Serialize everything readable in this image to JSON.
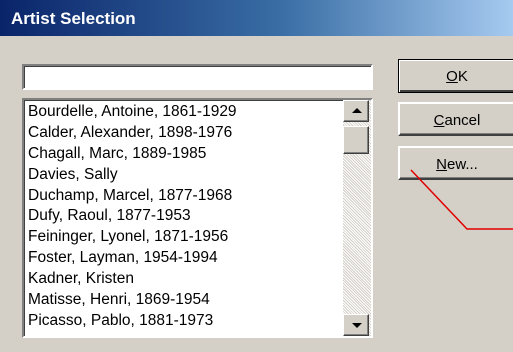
{
  "window": {
    "title": "Artist Selection"
  },
  "search": {
    "value": ""
  },
  "artists": [
    "Bourdelle, Antoine, 1861-1929",
    "Calder, Alexander, 1898-1976",
    "Chagall, Marc, 1889-1985",
    "Davies, Sally",
    "Duchamp, Marcel, 1877-1968",
    "Dufy, Raoul, 1877-1953",
    "Feininger, Lyonel, 1871-1956",
    "Foster, Layman, 1954-1994",
    "Kadner, Kristen",
    "Matisse, Henri, 1869-1954",
    "Picasso, Pablo, 1881-1973"
  ],
  "buttons": {
    "ok": {
      "mnemonic": "O",
      "rest": "K"
    },
    "cancel": {
      "mnemonic": "C",
      "rest": "ancel"
    },
    "new": {
      "mnemonic": "N",
      "rest": "ew..."
    }
  },
  "colors": {
    "annotation_line": "#e00000"
  },
  "icons": {
    "scroll_up": "triangle-up",
    "scroll_down": "triangle-down"
  }
}
